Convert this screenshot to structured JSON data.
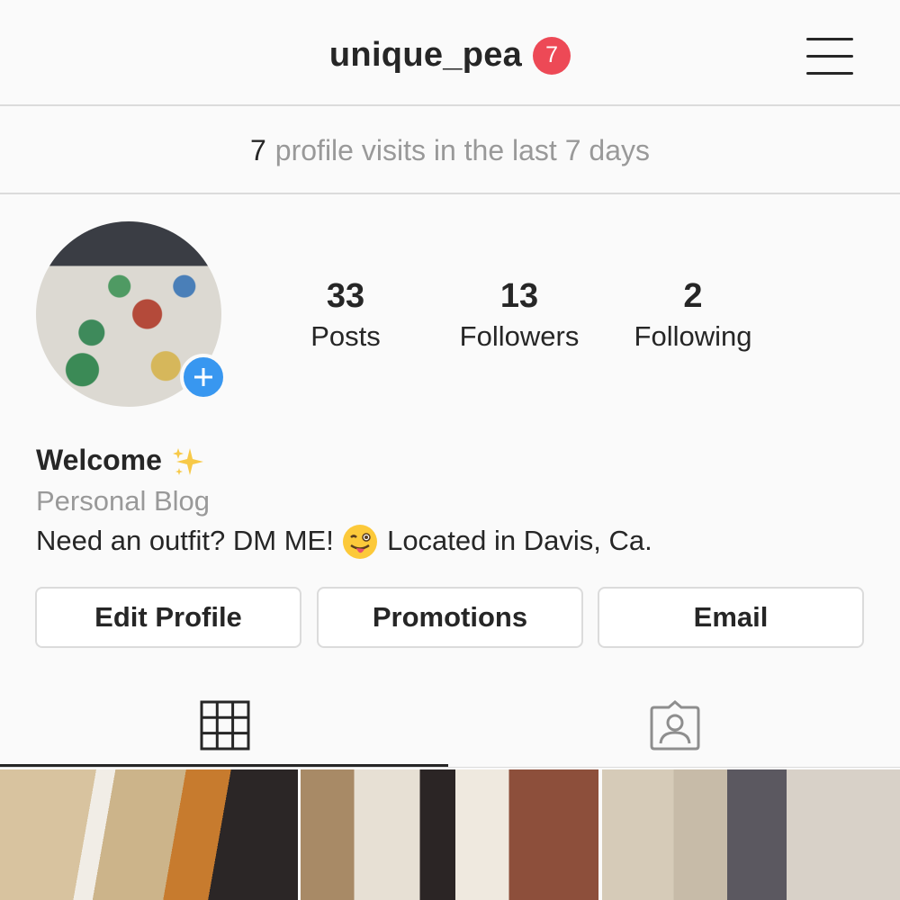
{
  "header": {
    "username": "unique_pea",
    "notification_count": "7",
    "menu_icon": "hamburger-menu-icon"
  },
  "profile_visits": {
    "count": "7",
    "text": "profile visits in the last 7 days"
  },
  "avatar": {
    "add_icon": "plus-icon"
  },
  "stats": {
    "posts": {
      "value": "33",
      "label": "Posts"
    },
    "followers": {
      "value": "13",
      "label": "Followers"
    },
    "following": {
      "value": "2",
      "label": "Following"
    }
  },
  "bio": {
    "name": "Welcome",
    "name_emoji": "sparkles-emoji",
    "category": "Personal Blog",
    "text_before": "Need an outfit? DM ME!",
    "text_emoji": "winking-tongue-emoji",
    "text_after": "Located in Davis, Ca."
  },
  "buttons": {
    "edit_profile": "Edit Profile",
    "promotions": "Promotions",
    "email": "Email"
  },
  "tabs": {
    "grid_icon": "grid-icon",
    "tagged_icon": "tagged-person-icon",
    "active": "grid"
  },
  "colors": {
    "badge": "#ed4956",
    "add_button": "#3897f0",
    "text": "#262626",
    "muted": "#999999",
    "border": "#dbdbdb"
  }
}
